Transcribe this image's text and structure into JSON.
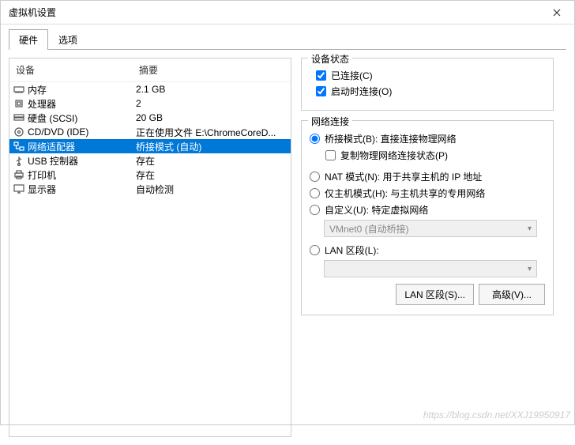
{
  "window": {
    "title": "虚拟机设置"
  },
  "tabs": {
    "hardware": "硬件",
    "options": "选项",
    "active": "hardware"
  },
  "list": {
    "header_device": "设备",
    "header_summary": "摘要",
    "rows": [
      {
        "icon": "memory-icon",
        "device": "内存",
        "summary": "2.1 GB",
        "selected": false
      },
      {
        "icon": "cpu-icon",
        "device": "处理器",
        "summary": "2",
        "selected": false
      },
      {
        "icon": "disk-icon",
        "device": "硬盘 (SCSI)",
        "summary": "20 GB",
        "selected": false
      },
      {
        "icon": "cd-icon",
        "device": "CD/DVD (IDE)",
        "summary": "正在使用文件 E:\\ChromeCoreD...",
        "selected": false
      },
      {
        "icon": "network-icon",
        "device": "网络适配器",
        "summary": "桥接模式 (自动)",
        "selected": true
      },
      {
        "icon": "usb-icon",
        "device": "USB 控制器",
        "summary": "存在",
        "selected": false
      },
      {
        "icon": "printer-icon",
        "device": "打印机",
        "summary": "存在",
        "selected": false
      },
      {
        "icon": "display-icon",
        "device": "显示器",
        "summary": "自动检测",
        "selected": false
      }
    ]
  },
  "device_status": {
    "title": "设备状态",
    "connected_label": "已连接(C)",
    "connected_checked": true,
    "connect_at_power_label": "启动时连接(O)",
    "connect_at_power_checked": true
  },
  "network": {
    "title": "网络连接",
    "bridged": {
      "label": "桥接模式(B): 直接连接物理网络",
      "checked": true
    },
    "replicate": {
      "label": "复制物理网络连接状态(P)",
      "checked": false
    },
    "nat": {
      "label": "NAT 模式(N): 用于共享主机的 IP 地址",
      "checked": false
    },
    "hostonly": {
      "label": "仅主机模式(H): 与主机共享的专用网络",
      "checked": false
    },
    "custom": {
      "label": "自定义(U): 特定虚拟网络",
      "checked": false,
      "combo": "VMnet0 (自动桥接)"
    },
    "lanseg": {
      "label": "LAN 区段(L):",
      "checked": false,
      "combo": ""
    },
    "btn_lanseg": "LAN 区段(S)...",
    "btn_advanced": "高级(V)..."
  },
  "watermark": "https://blog.csdn.net/XXJ19950917"
}
